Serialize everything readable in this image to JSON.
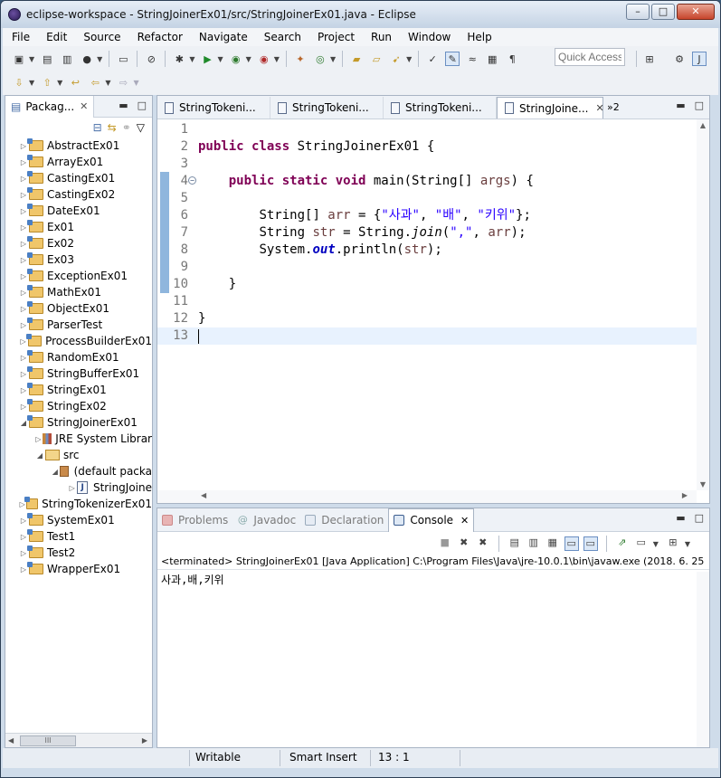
{
  "window": {
    "title": "eclipse-workspace - StringJoinerEx01/src/StringJoinerEx01.java - Eclipse",
    "buttons": [
      "–",
      "□",
      "✕"
    ]
  },
  "menu": [
    "File",
    "Edit",
    "Source",
    "Refactor",
    "Navigate",
    "Search",
    "Project",
    "Run",
    "Window",
    "Help"
  ],
  "toolbar": {
    "quick_access_placeholder": "Quick Access"
  },
  "package_explorer": {
    "tab_label": "Packag...",
    "items": [
      {
        "label": "AbstractEx01",
        "type": "project",
        "expanded": false
      },
      {
        "label": "ArrayEx01",
        "type": "project",
        "expanded": false
      },
      {
        "label": "CastingEx01",
        "type": "project",
        "expanded": false
      },
      {
        "label": "CastingEx02",
        "type": "project",
        "expanded": false
      },
      {
        "label": "DateEx01",
        "type": "project",
        "expanded": false
      },
      {
        "label": "Ex01",
        "type": "project",
        "expanded": false
      },
      {
        "label": "Ex02",
        "type": "project",
        "expanded": false
      },
      {
        "label": "Ex03",
        "type": "project",
        "expanded": false
      },
      {
        "label": "ExceptionEx01",
        "type": "project",
        "expanded": false
      },
      {
        "label": "MathEx01",
        "type": "project",
        "expanded": false
      },
      {
        "label": "ObjectEx01",
        "type": "project",
        "expanded": false
      },
      {
        "label": "ParserTest",
        "type": "project",
        "expanded": false
      },
      {
        "label": "ProcessBuilderEx01",
        "type": "project",
        "expanded": false
      },
      {
        "label": "RandomEx01",
        "type": "project",
        "expanded": false
      },
      {
        "label": "StringBufferEx01",
        "type": "project",
        "expanded": false
      },
      {
        "label": "StringEx01",
        "type": "project",
        "expanded": false
      },
      {
        "label": "StringEx02",
        "type": "project",
        "expanded": false
      },
      {
        "label": "StringJoinerEx01",
        "type": "project",
        "expanded": true
      },
      {
        "label": "JRE System Librar",
        "type": "library",
        "expanded": false
      },
      {
        "label": "src",
        "type": "src",
        "expanded": true
      },
      {
        "label": "(default packa",
        "type": "package",
        "expanded": true
      },
      {
        "label": "StringJoine",
        "type": "java",
        "expanded": false
      },
      {
        "label": "StringTokenizerEx01",
        "type": "project",
        "expanded": false
      },
      {
        "label": "SystemEx01",
        "type": "project",
        "expanded": false
      },
      {
        "label": "Test1",
        "type": "project",
        "expanded": false
      },
      {
        "label": "Test2",
        "type": "project",
        "expanded": false
      },
      {
        "label": "WrapperEx01",
        "type": "project",
        "expanded": false
      }
    ],
    "scroll_thumb": "III"
  },
  "editor": {
    "tabs": [
      {
        "label": "StringTokeni...",
        "active": false
      },
      {
        "label": "StringTokeni...",
        "active": false
      },
      {
        "label": "StringTokeni...",
        "active": false
      },
      {
        "label": "StringJoine...",
        "active": true
      }
    ],
    "overflow_label": "»2",
    "line_numbers": [
      "1",
      "2",
      "3",
      "4",
      "5",
      "6",
      "7",
      "8",
      "9",
      "10",
      "11",
      "12",
      "13"
    ],
    "code": {
      "l2_kw": "public class",
      "l2_rest": " StringJoinerEx01 {",
      "l4_kw": "public static void",
      "l4_a": " main(String[] ",
      "l4_param": "args",
      "l4_b": ") {",
      "l6_a": "String[] ",
      "l6_var": "arr",
      "l6_b": " = {",
      "l6_s1": "\"사과\"",
      "l6_c1": ", ",
      "l6_s2": "\"배\"",
      "l6_c2": ", ",
      "l6_s3": "\"키위\"",
      "l6_end": "};",
      "l7_a": "String ",
      "l7_var": "str",
      "l7_b": " = String.",
      "l7_m": "join",
      "l7_c": "(",
      "l7_s": "\",\"",
      "l7_d": ", ",
      "l7_var2": "arr",
      "l7_e": ");",
      "l8_a": "System.",
      "l8_f": "out",
      "l8_b": ".println(",
      "l8_var": "str",
      "l8_c": ");",
      "l10": "}",
      "l12": "}"
    }
  },
  "console": {
    "tabs": [
      {
        "label": "Problems",
        "active": false
      },
      {
        "label": "Javadoc",
        "active": false
      },
      {
        "label": "Declaration",
        "active": false
      },
      {
        "label": "Console",
        "active": true
      }
    ],
    "terminated": "<terminated> StringJoinerEx01 [Java Application] C:\\Program Files\\Java\\jre-10.0.1\\bin\\javaw.exe (2018. 6. 25",
    "output": "사과,배,키위"
  },
  "status": {
    "writable": "Writable",
    "insert_mode": "Smart Insert",
    "position": "13 : 1"
  },
  "colors": {
    "keyword": "#7f0055",
    "string": "#2a00ff",
    "field": "#0000c0",
    "current_line": "#e8f2fe"
  }
}
